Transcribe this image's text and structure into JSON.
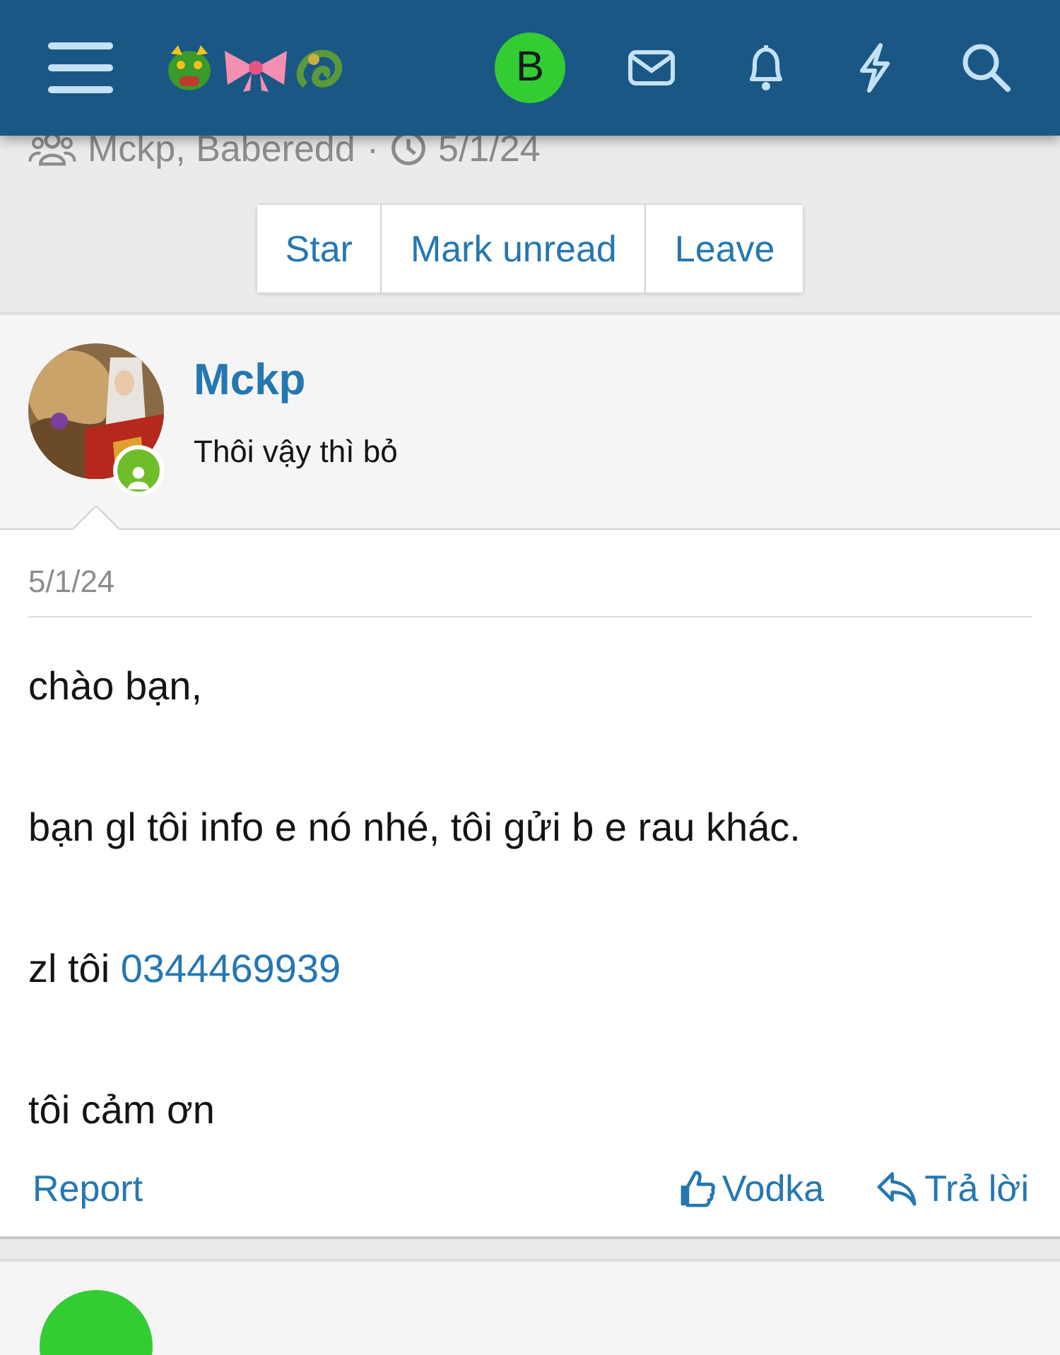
{
  "header": {
    "user_initial": "B"
  },
  "meta": {
    "participants": "Mckp, Baberedd",
    "separator": "·",
    "date": "5/1/24"
  },
  "actions": [
    "Star",
    "Mark unread",
    "Leave"
  ],
  "message": {
    "author": "Mckp",
    "subtitle": "Thôi vậy thì bỏ",
    "online": true,
    "date": "5/1/24",
    "paragraphs": [
      {
        "text": "chào bạn,"
      },
      {
        "text": "bạn gl tôi info e nó nhé, tôi gửi b e rau khác."
      },
      {
        "text": "zl tôi ",
        "link": "0344469939"
      },
      {
        "text": "tôi cảm ơn"
      }
    ],
    "report": "Report",
    "like_label": "Vodka",
    "reply_label": "Trả lời"
  }
}
